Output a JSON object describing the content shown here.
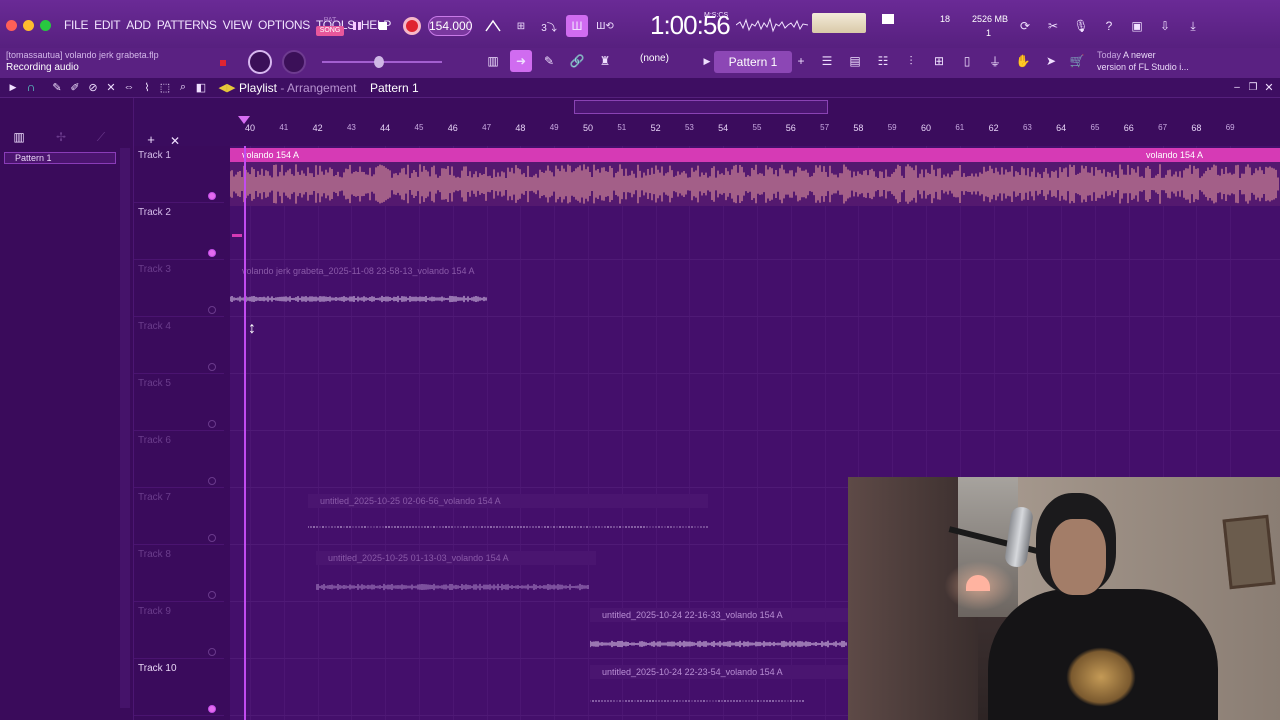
{
  "menubar": {
    "menu": [
      "FILE",
      "EDIT",
      "ADD",
      "PATTERNS",
      "VIEW",
      "OPTIONS",
      "TOOLS",
      "HELP"
    ],
    "pat_label": "PAT",
    "song_label": "SONG",
    "tempo": "154.000",
    "time": "1:00:56",
    "time_sub": "M:S:CS",
    "cpu": "18",
    "mem": "2526 MB",
    "mem_sub": "1"
  },
  "toolbar2": {
    "project": "[tomassautua] volando jerk grabeta.flp",
    "status": "Recording audio",
    "pattern_select": "(none)",
    "pattern_name": "Pattern 1",
    "news_today": "Today",
    "news_line1": "A newer",
    "news_line2": "version of FL Studio i..."
  },
  "playlist": {
    "title": "Playlist",
    "subtitle": "Arrangement",
    "pattern": "Pattern 1"
  },
  "picker": {
    "items": [
      "Pattern 1"
    ]
  },
  "ruler": {
    "ticks": [
      "40",
      "41",
      "42",
      "43",
      "44",
      "45",
      "46",
      "47",
      "48",
      "49",
      "50",
      "51",
      "52",
      "53",
      "54",
      "55",
      "56",
      "57",
      "58",
      "59",
      "60",
      "61",
      "62",
      "63",
      "64",
      "65",
      "66",
      "67",
      "68",
      "69"
    ]
  },
  "tracks": [
    {
      "name": "Track 1"
    },
    {
      "name": "Track 2"
    },
    {
      "name": "Track 3"
    },
    {
      "name": "Track 4"
    },
    {
      "name": "Track 5"
    },
    {
      "name": "Track 6"
    },
    {
      "name": "Track 7"
    },
    {
      "name": "Track 8"
    },
    {
      "name": "Track 9"
    },
    {
      "name": "Track 10"
    }
  ],
  "clips": {
    "c1": "volando 154 A",
    "c1b": "volando 154 A",
    "c3": "volando jerk grabeta_2025-11-08 23-58-13_volando 154 A",
    "c7": "untitled_2025-10-25 02-06-56_volando 154 A",
    "c8": "untitled_2025-10-25 01-13-03_volando 154 A",
    "c9": "untitled_2025-10-24 22-16-33_volando 154 A",
    "c10": "untitled_2025-10-24 22-23-54_volando 154 A"
  },
  "colors": {
    "accent": "#d63ab5",
    "background": "#440f6b",
    "waveform_main": "#f2a5a0"
  }
}
